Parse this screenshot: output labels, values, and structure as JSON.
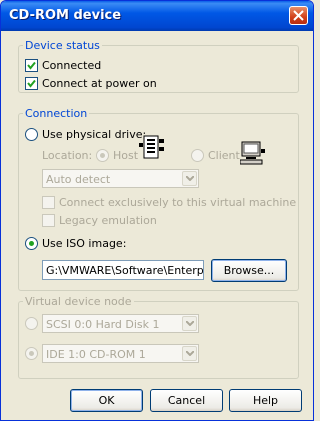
{
  "window": {
    "title": "CD-ROM device"
  },
  "device_status": {
    "legend": "Device status",
    "connected": {
      "label": "Connected",
      "checked": true
    },
    "connect_at_power_on": {
      "label": "Connect at power on",
      "checked": true
    }
  },
  "connection": {
    "legend": "Connection",
    "use_physical_drive": {
      "label": "Use physical drive:",
      "selected": false
    },
    "location_label": "Location:",
    "host": {
      "label": "Host",
      "selected": true,
      "enabled": false
    },
    "client": {
      "label": "Client",
      "selected": false,
      "enabled": false
    },
    "drive_select": {
      "value": "Auto detect",
      "enabled": false
    },
    "connect_exclusively": {
      "label": "Connect exclusively to this virtual machine",
      "checked": false,
      "enabled": false
    },
    "legacy_emulation": {
      "label": "Legacy emulation",
      "checked": false,
      "enabled": false
    },
    "use_iso_image": {
      "label": "Use ISO image:",
      "selected": true
    },
    "iso_path": "G:\\VMWARE\\Software\\Enterpri",
    "browse_label": "Browse..."
  },
  "virtual_device_node": {
    "legend": "Virtual device node",
    "scsi": {
      "value": "SCSI 0:0  Hard Disk 1",
      "selected": false,
      "enabled": false
    },
    "ide": {
      "value": "IDE 1:0  CD-ROM 1",
      "selected": true,
      "enabled": false
    }
  },
  "footer": {
    "ok_label": "OK",
    "cancel_label": "Cancel",
    "help_label": "Help"
  },
  "colors": {
    "title_bar": "#0054e3",
    "legend_text": "#0046d5",
    "dialog_bg": "#ece9d8",
    "radio_dot": "#21a121"
  }
}
